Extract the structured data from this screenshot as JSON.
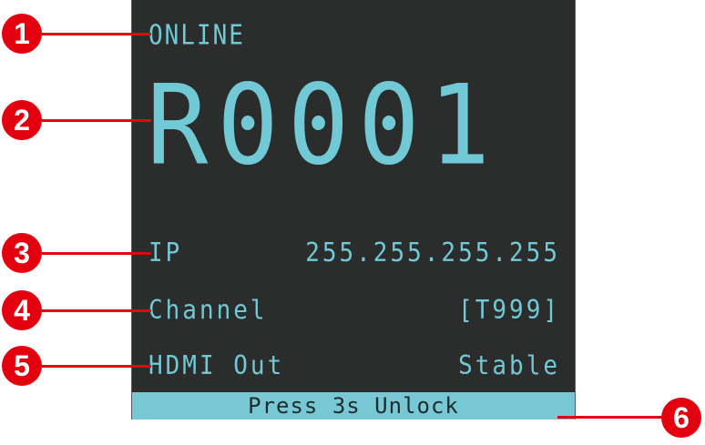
{
  "screen": {
    "status": "ONLINE",
    "device_id": "R0001",
    "rows": [
      {
        "label": "IP",
        "value": "255.255.255.255"
      },
      {
        "label": "Channel",
        "value": "[T999]"
      },
      {
        "label": "HDMI Out",
        "value": "Stable"
      }
    ],
    "unlock_text": "Press 3s Unlock"
  },
  "callouts": [
    "1",
    "2",
    "3",
    "4",
    "5",
    "6"
  ],
  "colors": {
    "screen_background": "#2b2d2d",
    "screen_text": "#72c9d6",
    "unlock_bar": "#77c8d4",
    "callout": "#e3000f"
  }
}
